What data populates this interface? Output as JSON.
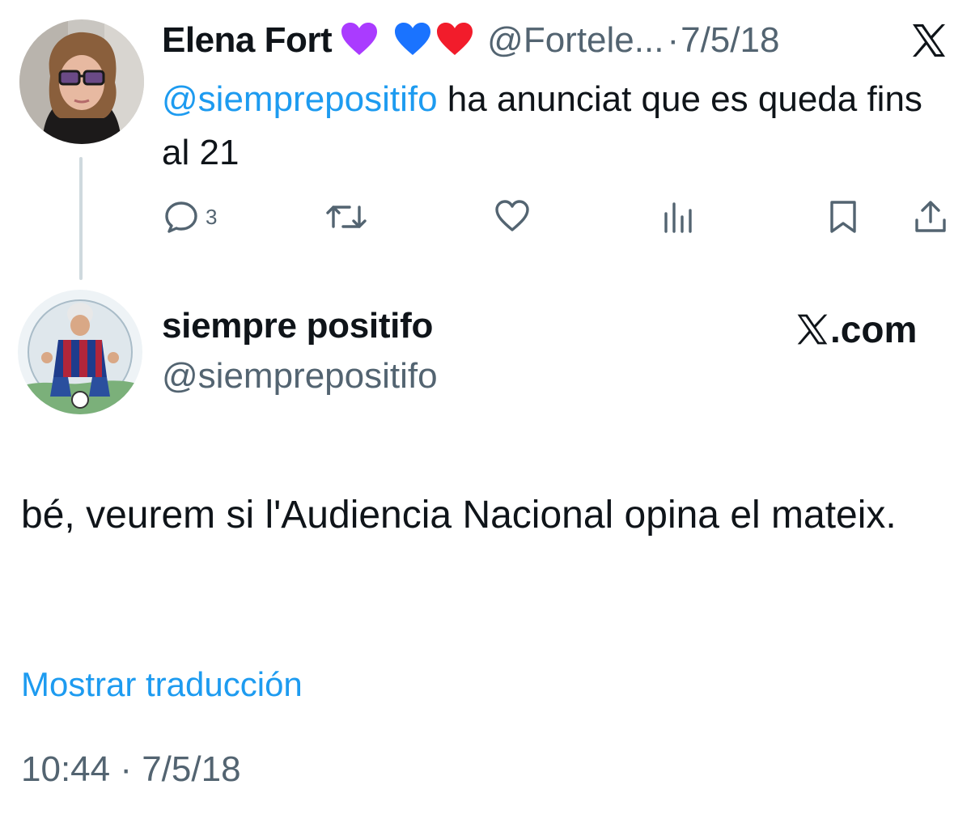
{
  "reply_tweet": {
    "author_name": "Elena Fort",
    "emoji": [
      "purple-heart",
      "blue-heart",
      "red-heart"
    ],
    "handle": "@Fortele...",
    "separator": "·",
    "date": "7/5/18",
    "mention": "@siemprepositifo",
    "text": " ha anunciat que es queda fins al 21",
    "actions": {
      "reply_count": "3",
      "icons": [
        "reply-icon",
        "retweet-icon",
        "like-icon",
        "views-icon",
        "bookmark-icon",
        "share-icon"
      ]
    }
  },
  "main_tweet": {
    "author_name": "siempre positifo",
    "handle": "@siemprepositifo",
    "text": "bé, veurem si l'Audiencia Nacional opina el mateix.",
    "translate_label": "Mostrar traducción",
    "timestamp": "10:44 · 7/5/18"
  },
  "brand": {
    "domain_suffix": ".com"
  },
  "colors": {
    "link": "#1d9bf0",
    "secondary_text": "#536471",
    "primary_text": "#0f1419",
    "thread_line": "#cfd9de"
  }
}
